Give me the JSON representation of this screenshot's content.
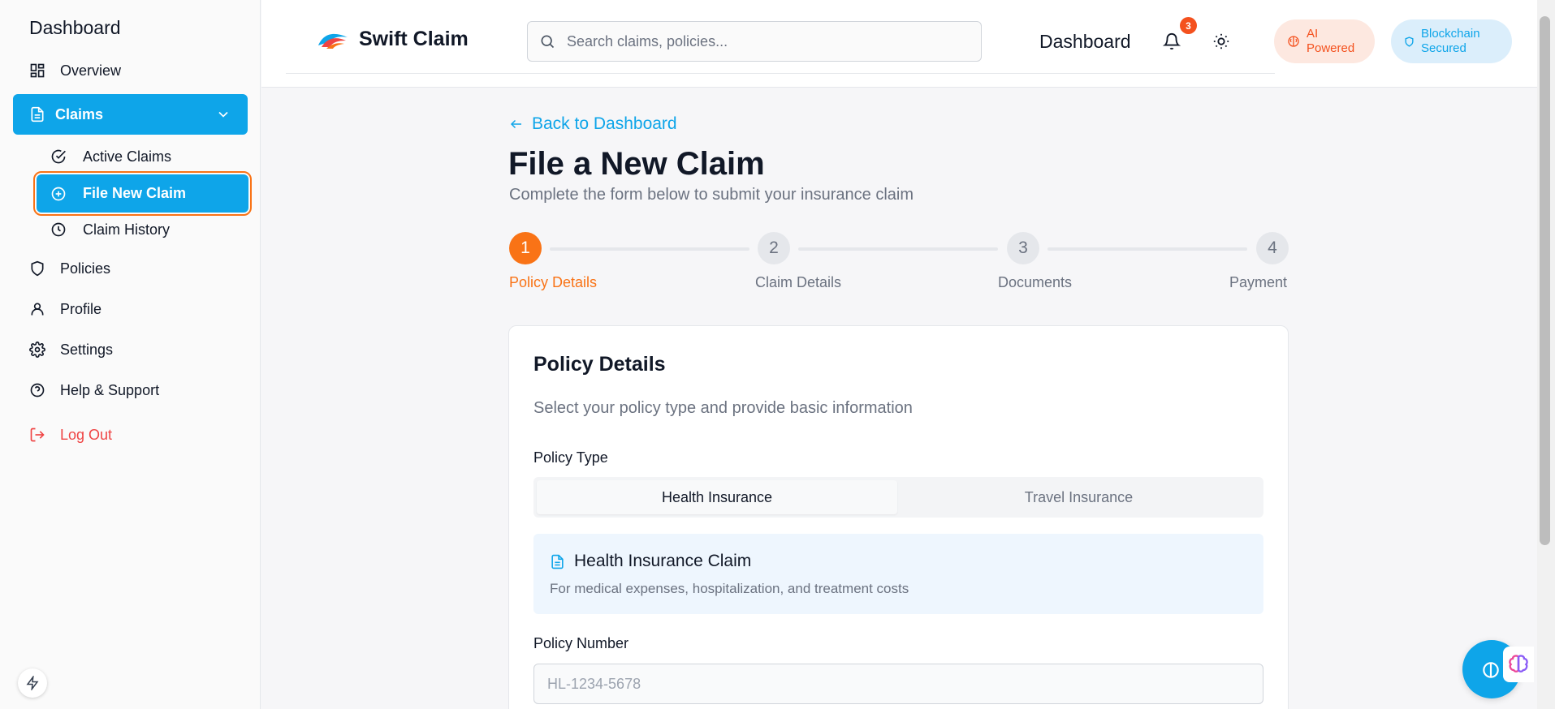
{
  "sidebar": {
    "title": "Dashboard",
    "items": {
      "overview": "Overview",
      "claims": "Claims",
      "active_claims": "Active Claims",
      "file_new_claim": "File New Claim",
      "claim_history": "Claim History",
      "policies": "Policies",
      "profile": "Profile",
      "settings": "Settings",
      "help": "Help & Support",
      "logout": "Log Out"
    }
  },
  "header": {
    "brand": "Swift Claim",
    "search_placeholder": "Search claims, policies...",
    "title": "Dashboard",
    "notification_count": "3",
    "ai_line1": "AI",
    "ai_line2": "Powered",
    "bc_line1": "Blockchain",
    "bc_line2": "Secured"
  },
  "main": {
    "back": "Back to Dashboard",
    "title": "File a New Claim",
    "subtitle": "Complete the form below to submit your insurance claim",
    "steps": [
      {
        "num": "1",
        "label": "Policy Details"
      },
      {
        "num": "2",
        "label": "Claim Details"
      },
      {
        "num": "3",
        "label": "Documents"
      },
      {
        "num": "4",
        "label": "Payment"
      }
    ],
    "card": {
      "title": "Policy Details",
      "description": "Select your policy type and provide basic information",
      "policy_type_label": "Policy Type",
      "tabs": [
        "Health Insurance",
        "Travel Insurance"
      ],
      "info_title": "Health Insurance Claim",
      "info_desc": "For medical expenses, hospitalization, and treatment costs",
      "policy_number_label": "Policy Number",
      "policy_number_placeholder": "HL-1234-5678"
    }
  },
  "colors": {
    "accent": "#0ea5e9",
    "active_step": "#f97316",
    "danger": "#ef4444"
  }
}
